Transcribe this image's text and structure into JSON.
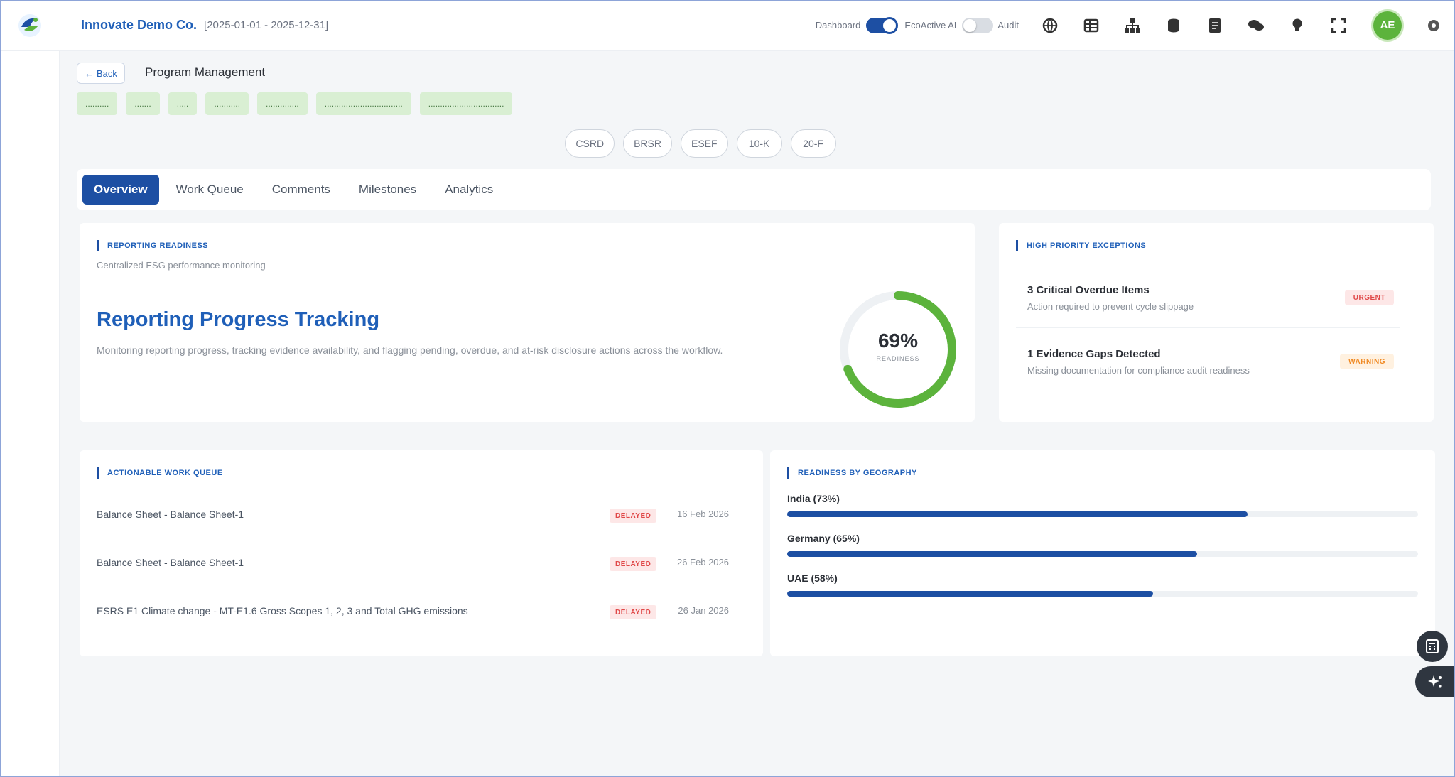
{
  "header": {
    "company": "Innovate Demo Co.",
    "date_range": "[2025-01-01 - 2025-12-31]",
    "toggle_dashboard_label": "Dashboard",
    "toggle_ecoactive_label": "EcoActive AI",
    "toggle_audit_label": "Audit",
    "avatar_initials": "AE",
    "icons": [
      "globe-icon",
      "table-icon",
      "hierarchy-icon",
      "database-icon",
      "document-icon",
      "chat-icon",
      "lightbulb-icon",
      "fullscreen-icon",
      "settings-icon"
    ]
  },
  "page": {
    "back_label": "Back",
    "title": "Program Management"
  },
  "chips": [
    "..........",
    ".......",
    ".....",
    "...........",
    "..............",
    ".................................",
    "................................"
  ],
  "frameworks": [
    "CSRD",
    "BRSR",
    "ESEF",
    "10-K",
    "20-F"
  ],
  "tabs": [
    "Overview",
    "Work Queue",
    "Comments",
    "Milestones",
    "Analytics"
  ],
  "readiness": {
    "label": "Reporting Readiness",
    "subtitle": "Centralized ESG performance monitoring",
    "title": "Reporting Progress Tracking",
    "description": "Monitoring reporting progress, tracking evidence availability, and flagging pending, overdue, and at-risk disclosure actions across the workflow.",
    "percent_text": "69%",
    "percent_value": 69,
    "caption": "Readiness"
  },
  "exceptions": {
    "label": "High Priority Exceptions",
    "items": [
      {
        "title": "3 Critical Overdue Items",
        "subtitle": "Action required to prevent cycle slippage",
        "badge": "Urgent"
      },
      {
        "title": "1 Evidence Gaps Detected",
        "subtitle": "Missing documentation for compliance audit readiness",
        "badge": "Warning"
      }
    ]
  },
  "work_queue": {
    "label": "Actionable Work Queue",
    "rows": [
      {
        "title": "Balance Sheet - Balance Sheet-1",
        "status": "Delayed",
        "date": "16 Feb 2026"
      },
      {
        "title": "Balance Sheet - Balance Sheet-1",
        "status": "Delayed",
        "date": "26 Feb 2026"
      },
      {
        "title": "ESRS E1 Climate change - MT-E1.6 Gross Scopes 1, 2, 3 and Total GHG emissions",
        "status": "Delayed",
        "date": "26 Jan 2026"
      }
    ]
  },
  "geography": {
    "label": "Readiness by Geography",
    "items": [
      {
        "label": "India (73%)",
        "value": 73
      },
      {
        "label": "Germany (65%)",
        "value": 65
      },
      {
        "label": "UAE (58%)",
        "value": 58
      }
    ]
  },
  "colors": {
    "accent": "#1d4fa3",
    "brand_text": "#1f5fb8",
    "success": "#5cb33c",
    "urgent": "#e04848",
    "warning": "#f08a24"
  }
}
